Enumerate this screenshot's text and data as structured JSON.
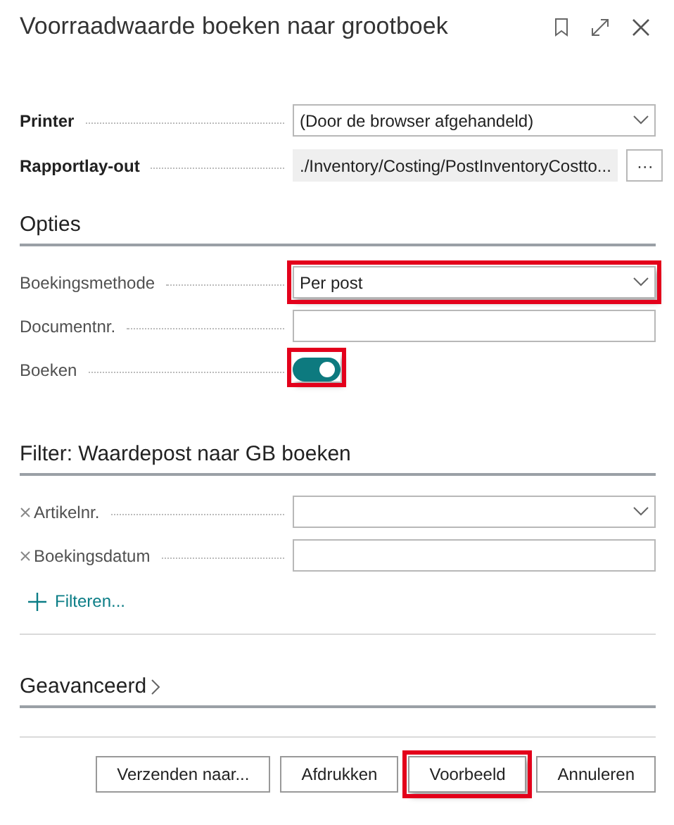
{
  "window": {
    "title": "Voorraadwaarde boeken naar grootboek"
  },
  "header_fields": [
    {
      "label": "Printer",
      "kind": "dropdown",
      "value": "(Door de browser afgehandeld)",
      "highlighted": false
    },
    {
      "label": "Rapportlay-out",
      "kind": "lookup",
      "value": "./Inventory/Costing/PostInventoryCostto...",
      "lookup_button": "···",
      "highlighted": false
    }
  ],
  "sections": [
    {
      "title": "Opties",
      "expanded": true,
      "fields": [
        {
          "label": "Boekingsmethode",
          "kind": "dropdown",
          "value": "Per post",
          "removable": false,
          "highlighted": true
        },
        {
          "label": "Documentnr.",
          "kind": "text",
          "removable": false,
          "highlighted": false
        },
        {
          "label": "Boeken",
          "kind": "toggle",
          "on": true,
          "removable": false,
          "highlighted": true
        }
      ]
    },
    {
      "title": "Filter: Waardepost naar GB boeken",
      "expanded": true,
      "fields": [
        {
          "label": "Artikelnr.",
          "kind": "dropdown",
          "removable": true,
          "highlighted": false
        },
        {
          "label": "Boekingsdatum",
          "kind": "text",
          "removable": true,
          "highlighted": false
        }
      ],
      "add_filter": "Filteren..."
    },
    {
      "title": "Geavanceerd",
      "expanded": false
    }
  ],
  "buttons": [
    {
      "label": "Verzenden naar...",
      "highlighted": false
    },
    {
      "label": "Afdrukken",
      "highlighted": false
    },
    {
      "label": "Voorbeeld",
      "highlighted": true
    },
    {
      "label": "Annuleren",
      "highlighted": false
    }
  ]
}
